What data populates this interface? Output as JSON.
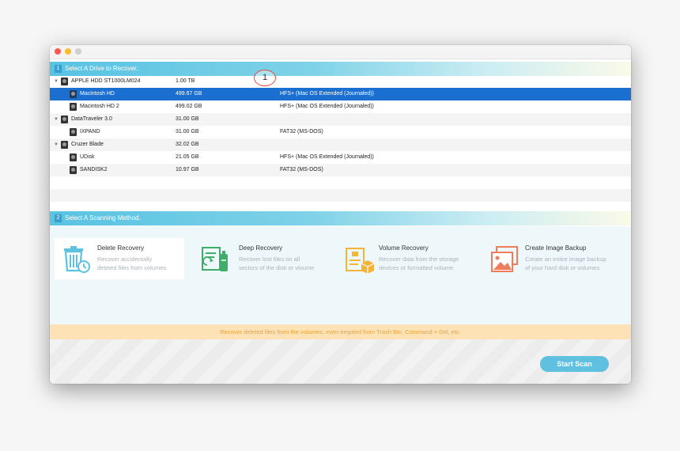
{
  "section1": {
    "number": "1",
    "title": "Select A Drive to Recover."
  },
  "section2": {
    "number": "2",
    "title": "Select A Scanning Method."
  },
  "marker": "1",
  "drives": [
    {
      "name": "APPLE HDD ST1000LM024",
      "size": "1.00 TB",
      "fs": "",
      "level": 0,
      "selected": false
    },
    {
      "name": "Macintosh HD",
      "size": "499.67 GB",
      "fs": "HFS+ (Mac OS Extended (Journaled))",
      "level": 1,
      "selected": true
    },
    {
      "name": "Macintosh HD 2",
      "size": "499.02 GB",
      "fs": "HFS+ (Mac OS Extended (Journaled))",
      "level": 1,
      "selected": false
    },
    {
      "name": "DataTraveler 3.0",
      "size": "31.00 GB",
      "fs": "",
      "level": 0,
      "selected": false
    },
    {
      "name": "IXPAND",
      "size": "31.00 GB",
      "fs": "FAT32 (MS-DOS)",
      "level": 1,
      "selected": false
    },
    {
      "name": "Cruzer Blade",
      "size": "32.02 GB",
      "fs": "",
      "level": 0,
      "selected": false
    },
    {
      "name": "UDisk",
      "size": "21.05 GB",
      "fs": "HFS+ (Mac OS Extended (Journaled))",
      "level": 1,
      "selected": false
    },
    {
      "name": "SANDISK2",
      "size": "10.97 GB",
      "fs": "FAT32 (MS-DOS)",
      "level": 1,
      "selected": false
    }
  ],
  "methods": [
    {
      "title": "Delete Recovery",
      "desc1": "Recover accidentally",
      "desc2": "deleted files from volumes",
      "icon": "trash-clock-icon",
      "color": "#5bc3e0"
    },
    {
      "title": "Deep Recovery",
      "desc1": "Recover lost files on all",
      "desc2": "sectors of the disk or vloume",
      "icon": "document-scan-icon",
      "color": "#3fae6a"
    },
    {
      "title": "Volume Recovery",
      "desc1": "Recover data from the storage",
      "desc2": "devices or formatted volume",
      "icon": "volume-box-icon",
      "color": "#f4b43a"
    },
    {
      "title": "Create Image Backup",
      "desc1": "Create an entire image backup",
      "desc2": "of your hard disk or volumes",
      "icon": "image-backup-icon",
      "color": "#ef7c5a"
    }
  ],
  "info_text": "Recover deleted files from the volumes, even emptied from Trash Bin, Command + Del, etc.",
  "start_scan_label": "Start Scan",
  "colors": {
    "accent": "#5fc1df",
    "selection": "#1a6fd1",
    "info_bg": "#fde2b6",
    "info_text": "#e8a43c"
  }
}
